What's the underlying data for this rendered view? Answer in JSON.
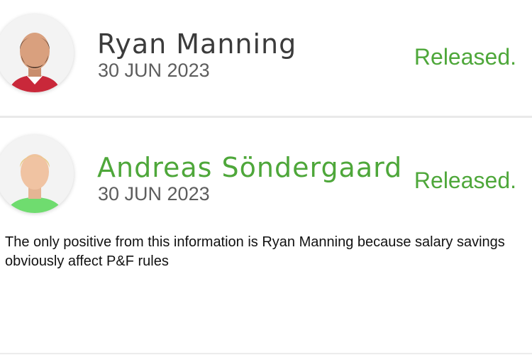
{
  "players": [
    {
      "name": "Ryan Manning",
      "date": "30 JUN 2023",
      "status": "Released.",
      "name_color": "#3b3b3b"
    },
    {
      "name": "Andreas Söndergaard",
      "date": "30 JUN 2023",
      "status": "Released.",
      "name_color": "#4ea73a"
    }
  ],
  "comment": "The only positive from this information is Ryan Manning because salary savings obviously affect P&F rules",
  "colors": {
    "accent_green": "#4ea73a"
  }
}
